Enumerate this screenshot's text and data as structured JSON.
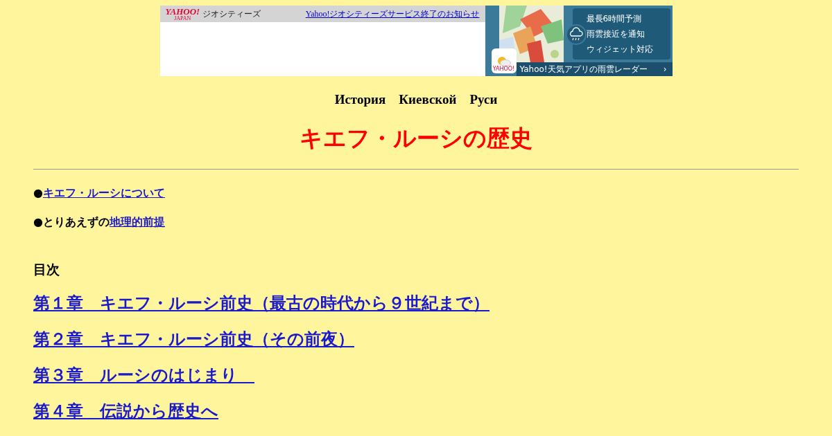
{
  "banner": {
    "logo": "YAHOO!",
    "logo_sub": "JAPAN",
    "service": "ジオシティーズ",
    "notice_link": "Yahoo!ジオシティーズサービス終了のお知らせ",
    "ad": {
      "features": [
        "最長6時間予測",
        "雨雲接近を通知",
        "ウィジェット対応"
      ],
      "app_label": "YAHOO!",
      "cta": "Yahoo!天気アプリの雨雲レーダー",
      "cta_arrow": "›"
    }
  },
  "subtitle": "История　Киевской　Руси",
  "title": "キエフ・ルーシの歴史",
  "intro": [
    {
      "bullet": "●",
      "link": "キエフ・ルーシについて"
    },
    {
      "bullet": "●",
      "prefix": "とりあえずの",
      "link": "地理的前提"
    }
  ],
  "toc_heading": "目次",
  "chapters": [
    "第１章　キエフ・ルーシ前史（最古の時代から９世紀まで）",
    "第２章　キエフ・ルーシ前史（その前夜）",
    "第３章　ルーシのはじまり　",
    "第４章　伝説から歴史へ"
  ]
}
